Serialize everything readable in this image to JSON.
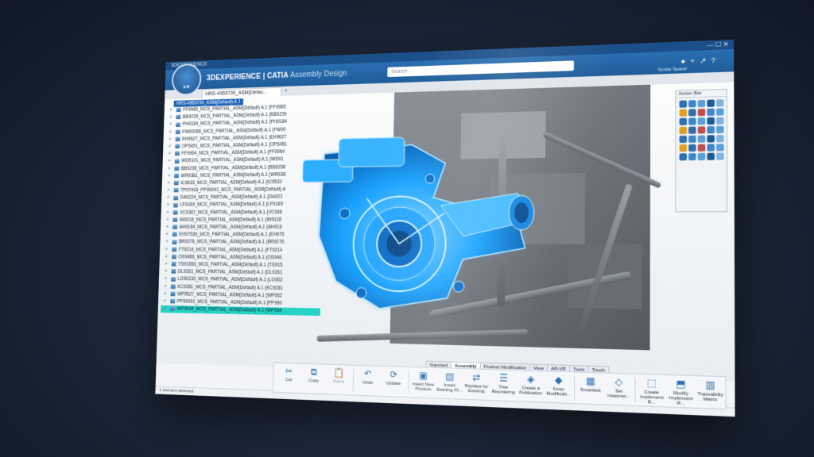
{
  "window": {
    "title": "3DEXPERIENCE",
    "brand": "3DEXPERIENCE",
    "brand_sep": " | ",
    "app": "CATIA",
    "app_sub": "Assembly Design",
    "compass_version": "V.R"
  },
  "search": {
    "placeholder": "Search"
  },
  "user": {
    "space": "Scotts Space"
  },
  "tab": {
    "label": "HRS-4953739_ASM(Defau...",
    "add": "+"
  },
  "tree": {
    "root": "HRS-4953739_ASM(Default) A.1",
    "items": [
      "FF9965_MCS_PARTIAL_ASM(Default) A.1 (FF9965",
      "BB9239_MCS_PARTIAL_ASM(Default) A.1 (BB9239",
      "PH9184_MCS_PARTIAL_ASM(Default) A.1 (PH9184",
      "FW90086_MCS_PARTIAL_ASM(Default) A.1 (FW90",
      "EH9627_MCS_PARTIAL_ASM(Default) A.1 (EH9627",
      "OP5451_MCS_PARTIAL_ASM(Default) A.1 (OP5451",
      "FF9964_MCS_PARTIAL_ASM(Default) A.1 (FF9964",
      "WD9101_MCS_PARTIAL_ASM(Default) A.1 (WD91",
      "BB9238_MCS_PARTIAL_ASM(Default) A.1 (BB9238",
      "WR9381_MCS_PARTIAL_ASM(Default) A.1 (WR938",
      "IC9533_MCS_PARTIAL_ASM(Default) A.1 (IC9533",
      "TP97403_PP99091_MCS_PARTIAL_ASM(Default) A",
      "DA9224_MCS_PARTIAL_ASM(Default) A.1 (DA922",
      "LF9169_MCS_PARTIAL_ASM(Default) A.1 (LF9169",
      "VC9367_MCS_PARTIAL_ASM(Default) A.1 (VC936",
      "IM9118_MCS_PARTIAL_ASM(Default) A.1 (IM9118",
      "AH9184_MCS_PARTIAL_ASM(Default) A.1 (AH918",
      "EH97536_MCS_PARTIAL_ASM(Default) A.1 (EH975",
      "BR9276_MCS_PARTIAL_ASM(Default) A.1 (BR9276",
      "FT9214_MCS_PARTIAL_ASM(Default) A.1 (FT9214",
      "OS9466_MCS_PARTIAL_ASM(Default) A.1 (OS946",
      "TS91553_MCS_PARTIAL_ASM(Default) A.1 (TS915",
      "DL9261_MCS_PARTIAL_ASM(Default) A.1 (DL9261",
      "LG90230_MCS_PARTIAL_ASM(Default) A.1 (LG902",
      "KC9281_MCS_PARTIAL_ASM(Default) A.1 (KC9281",
      "WP9527_MCS_PARTIAL_ASM(Default) A.1 (WP952",
      "PP99091_MCS_PARTIAL_ASM(Default) A.1 (PP990"
    ],
    "selected": "WP9544_MCS_PARTIAL_ASM(Default) A.1 (WP954"
  },
  "tool_palette": {
    "title": "Action Bar"
  },
  "action_tabs": [
    "Standard",
    "Assembly",
    "Product Modification",
    "View",
    "AR-VR",
    "Tools",
    "Touch"
  ],
  "action_tabs_active": 1,
  "actions": [
    {
      "label": "Cut",
      "icon": "scissors-icon",
      "glyph": "✂",
      "enabled": true
    },
    {
      "label": "Copy",
      "icon": "copy-icon",
      "glyph": "⧉",
      "enabled": true
    },
    {
      "label": "Paste",
      "icon": "paste-icon",
      "glyph": "📋",
      "enabled": false
    },
    {
      "label": "Undo",
      "icon": "undo-icon",
      "glyph": "↶",
      "enabled": true
    },
    {
      "label": "Update",
      "icon": "update-icon",
      "glyph": "⟳",
      "enabled": true
    },
    {
      "label": "Insert New Product",
      "icon": "insert-new-product-icon",
      "glyph": "▣",
      "enabled": true
    },
    {
      "label": "Insert Existing Pr...",
      "icon": "insert-existing-icon",
      "glyph": "▤",
      "enabled": true
    },
    {
      "label": "Replace by Existing",
      "icon": "replace-icon",
      "glyph": "⇄",
      "enabled": true
    },
    {
      "label": "Tree Reordering",
      "icon": "tree-reorder-icon",
      "glyph": "☰",
      "enabled": true
    },
    {
      "label": "Create a Publication",
      "icon": "publication-icon",
      "glyph": "◈",
      "enabled": true
    },
    {
      "label": "Keep Modificati...",
      "icon": "keep-mod-icon",
      "glyph": "◆",
      "enabled": true
    },
    {
      "label": "Smartlest",
      "icon": "smart-icon",
      "glyph": "▦",
      "enabled": true
    },
    {
      "label": "Set Interpret...",
      "icon": "interpret-icon",
      "glyph": "◇",
      "enabled": true
    },
    {
      "label": "Create Implement R...",
      "icon": "implement-icon",
      "glyph": "⬚",
      "enabled": true
    },
    {
      "label": "Modify Implement R...",
      "icon": "modify-implement-icon",
      "glyph": "⬒",
      "enabled": true
    },
    {
      "label": "Traceability Matrix",
      "icon": "matrix-icon",
      "glyph": "▥",
      "enabled": true
    }
  ],
  "status": {
    "text": "1 element selected"
  },
  "colors": {
    "accent": "#1f5c99",
    "highlight": "#27d3c7",
    "pump": "#1aa3ff"
  }
}
